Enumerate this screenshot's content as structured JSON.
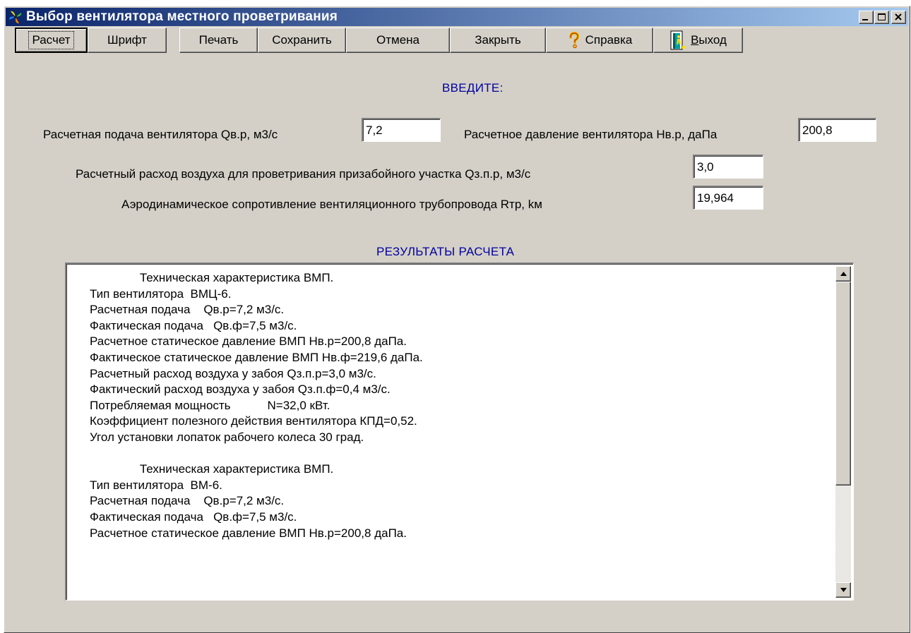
{
  "window": {
    "title": "Выбор вентилятора местного проветривания",
    "icon": "fan-app-icon",
    "controls": [
      "minimize-icon",
      "maximize-icon",
      "close-icon"
    ]
  },
  "toolbar": {
    "calc_label": "Расчет",
    "font_label": "Шрифт",
    "print_label": "Печать",
    "save_label": "Сохранить",
    "cancel_label": "Отмена",
    "close_label": "Закрыть",
    "help_label": "Справка",
    "exit_label_first": "В",
    "exit_label_rest": "ыход",
    "help_icon": "question-mark-icon",
    "exit_icon": "door-exit-icon"
  },
  "input": {
    "heading": "ВВЕДИТЕ:",
    "supply_label": "Расчетная подача  вентилятора Qв.р, м3/с",
    "supply_value": "7,2",
    "pressure_label": "Расчетное давление вентилятора Нв.р, даПа",
    "pressure_value": "200,8",
    "airflow_label": "Расчетный расход воздуха для проветривания призабойного участка  Qз.п.р, м3/с",
    "airflow_value": "3,0",
    "resistance_label": "Аэродинамическое сопротивление вентиляционного трубопровода Rтр, kм",
    "resistance_value": "19,964"
  },
  "results": {
    "heading": "РЕЗУЛЬТАТЫ РАСЧЕТА",
    "lines": [
      "               Техническая характеристика ВМП.",
      "Тип вентилятора  ВМЦ-6.",
      "Расчетная подача    Qв.р=7,2 м3/с.",
      "Фактическая подача   Qв.ф=7,5 м3/с.",
      "Расчетное статическое давление ВМП Нв.р=200,8 даПа.",
      "Фактическое статическое давление ВМП Нв.ф=219,6 даПа.",
      "Расчетный расход воздуха у забоя Qз.п.р=3,0 м3/с.",
      "Фактический расход воздуха у забоя Qз.п.ф=0,4 м3/с.",
      "Потребляемая мощность           N=32,0 кВт.",
      "Коэффициент полезного действия вентилятора КПД=0,52.",
      "Угол установки лопаток рабочего колеса 30 град.",
      "",
      "               Техническая характеристика ВМП.",
      "Тип вентилятора  ВМ-6.",
      "Расчетная подача    Qв.р=7,2 м3/с.",
      "Фактическая подача   Qв.ф=7,5 м3/с.",
      "Расчетное статическое давление ВМП Нв.р=200,8 даПа."
    ]
  }
}
